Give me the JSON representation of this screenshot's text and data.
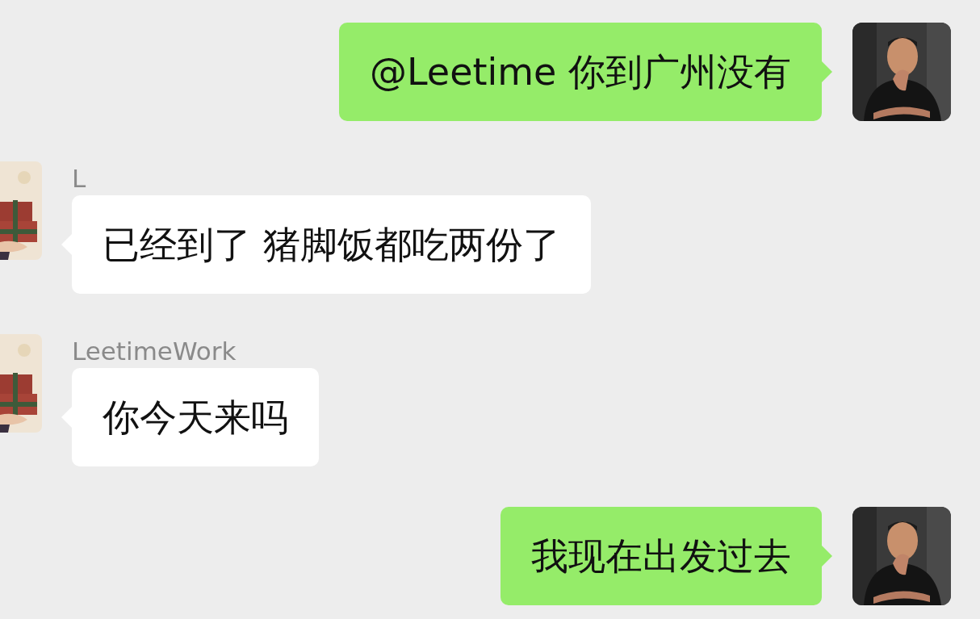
{
  "messages": [
    {
      "kind": "outgoing",
      "text": "@Leetime 你到广州没有"
    },
    {
      "kind": "incoming",
      "sender": "L",
      "text": "已经到了 猪脚饭都吃两份了"
    },
    {
      "kind": "incoming",
      "sender": "LeetimeWork",
      "text": "你今天来吗"
    },
    {
      "kind": "outgoing",
      "text": "我现在出发过去"
    }
  ]
}
